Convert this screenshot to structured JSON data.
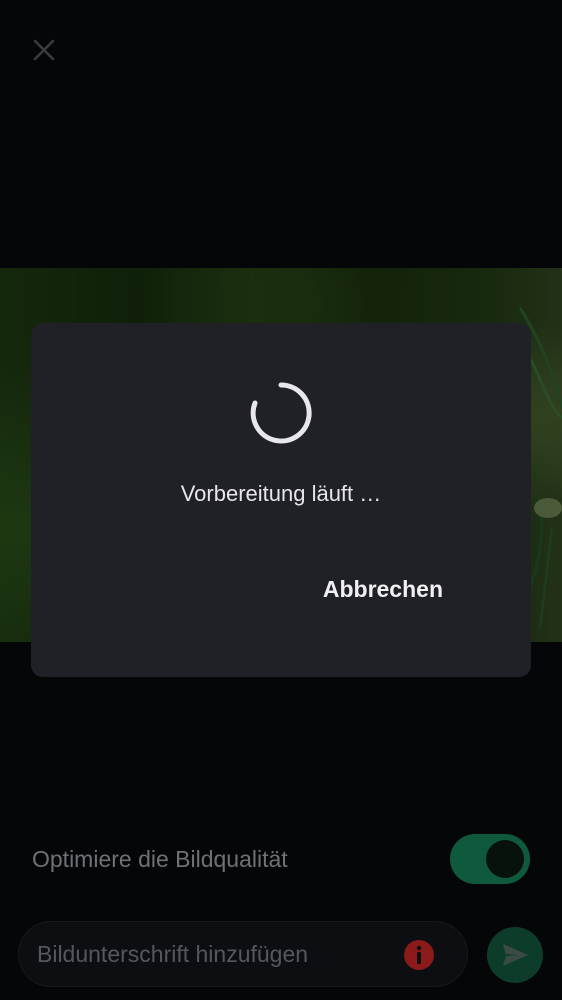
{
  "header": {
    "close_icon": "close-icon"
  },
  "dialog": {
    "progress_text": "Vorbereitung läuft …",
    "cancel_label": "Abbrechen",
    "spinner_icon": "loading-spinner-icon"
  },
  "options": {
    "optimize_label": "Optimiere die Bildqualität",
    "optimize_enabled": true
  },
  "composer": {
    "caption_placeholder": "Bildunterschrift hinzufügen",
    "info_icon": "info-icon",
    "send_icon": "send-icon"
  },
  "colors": {
    "background": "#090b0f",
    "dialog": "#202127",
    "accent": "#0f5a3c",
    "error": "#8b1a1a"
  }
}
